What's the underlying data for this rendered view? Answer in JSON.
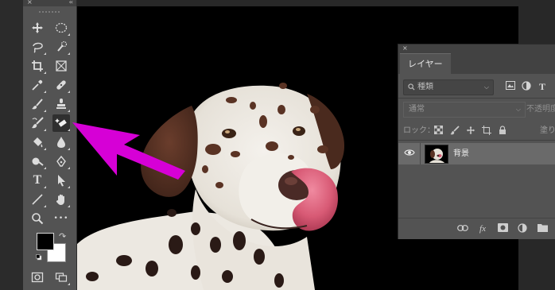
{
  "toolbar": {
    "close_glyph": "×",
    "collapse_glyph": "‹‹",
    "tools": [
      {
        "name": "move-icon"
      },
      {
        "name": "marquee-ellipse-icon"
      },
      {
        "name": "lasso-icon"
      },
      {
        "name": "quick-selection-icon"
      },
      {
        "name": "crop-icon"
      },
      {
        "name": "frame-icon"
      },
      {
        "name": "eyedropper-icon"
      },
      {
        "name": "healing-brush-icon"
      },
      {
        "name": "brush-icon"
      },
      {
        "name": "clone-stamp-icon"
      },
      {
        "name": "history-brush-icon"
      },
      {
        "name": "magic-eraser-icon"
      },
      {
        "name": "paint-bucket-icon"
      },
      {
        "name": "blur-icon"
      },
      {
        "name": "dodge-icon"
      },
      {
        "name": "pen-icon"
      },
      {
        "name": "type-icon"
      },
      {
        "name": "path-selection-icon"
      },
      {
        "name": "line-icon"
      },
      {
        "name": "hand-icon"
      },
      {
        "name": "zoom-icon"
      },
      {
        "name": "more-tools-icon"
      }
    ],
    "type_tool_glyph": "T",
    "more_glyph": "•••",
    "foreground_color": "#000000",
    "background_color": "#ffffff",
    "highlight_color": "#d600d6"
  },
  "layers_panel": {
    "close_glyph": "×",
    "tab_label": "レイヤー",
    "filter": {
      "search_glyph": "🔍",
      "value": "種類"
    },
    "filter_type_icons": [
      "image-filter-icon",
      "adjustment-filter-icon",
      "type-filter-icon"
    ],
    "type_filter_glyph": "T",
    "blend_mode": "通常",
    "opacity_label": "不透明度",
    "lock_label": "ロック：",
    "fill_label": "塗り",
    "layer": {
      "name": "背景",
      "visible_glyph": "👁"
    },
    "footer_icons": [
      "link-icon",
      "fx-icon",
      "mask-icon",
      "adjustment-layer-icon",
      "folder-icon"
    ],
    "fx_glyph": "fx"
  }
}
